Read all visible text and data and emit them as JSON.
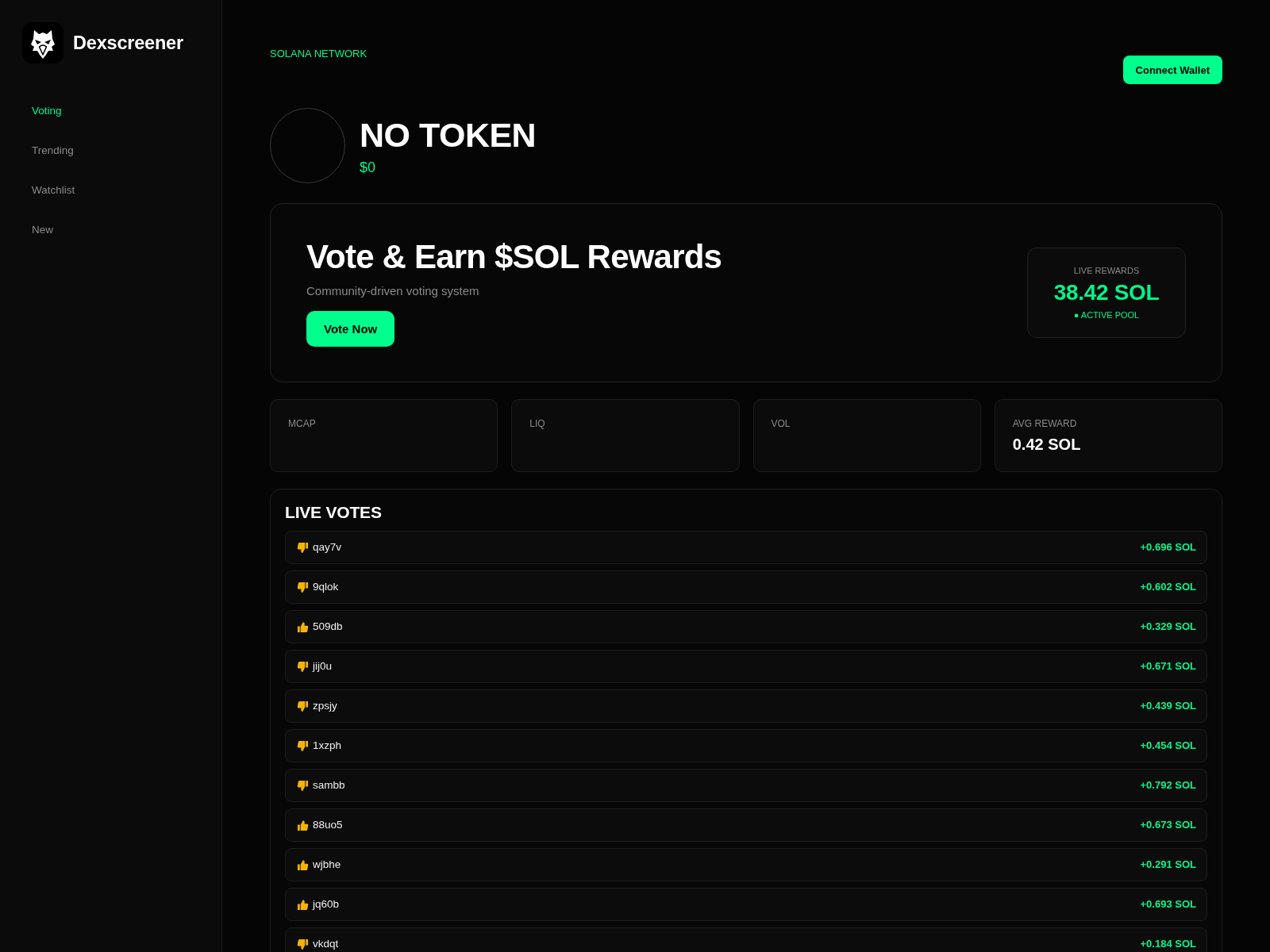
{
  "sidebar": {
    "brand": "Dexscreener",
    "items": [
      {
        "label": "Voting",
        "selected": true
      },
      {
        "label": "Trending",
        "selected": false
      },
      {
        "label": "Watchlist",
        "selected": false
      },
      {
        "label": "New",
        "selected": false
      }
    ]
  },
  "header": {
    "network": "SOLANA NETWORK",
    "connect_button": "Connect Wallet"
  },
  "token": {
    "name": "NO TOKEN",
    "price": "$0"
  },
  "banner": {
    "title": "Vote & Earn $SOL Rewards",
    "subtitle": "Community-driven voting system",
    "button": "Vote Now",
    "rewards": {
      "label": "LIVE REWARDS",
      "amount": "38.42 SOL",
      "status": "● ACTIVE POOL"
    }
  },
  "stats": [
    {
      "label": "MCAP"
    },
    {
      "label": "LIQ"
    },
    {
      "label": "VOL"
    },
    {
      "label": "AVG REWARD",
      "value": "0.42 SOL"
    }
  ],
  "live_votes": {
    "title": "LIVE VOTES",
    "votes": [
      {
        "kind": "down",
        "user": "qay7v",
        "reward": "+0.696 SOL"
      },
      {
        "kind": "down",
        "user": "9qlok",
        "reward": "+0.602 SOL"
      },
      {
        "kind": "up",
        "user": "509db",
        "reward": "+0.329 SOL"
      },
      {
        "kind": "down",
        "user": "jij0u",
        "reward": "+0.671 SOL"
      },
      {
        "kind": "down",
        "user": "zpsjy",
        "reward": "+0.439 SOL"
      },
      {
        "kind": "down",
        "user": "1xzph",
        "reward": "+0.454 SOL"
      },
      {
        "kind": "down",
        "user": "sambb",
        "reward": "+0.792 SOL"
      },
      {
        "kind": "up",
        "user": "88uo5",
        "reward": "+0.673 SOL"
      },
      {
        "kind": "up",
        "user": "wjbhe",
        "reward": "+0.291 SOL"
      },
      {
        "kind": "up",
        "user": "jq60b",
        "reward": "+0.693 SOL"
      },
      {
        "kind": "down",
        "user": "vkdqt",
        "reward": "+0.184 SOL"
      }
    ]
  }
}
